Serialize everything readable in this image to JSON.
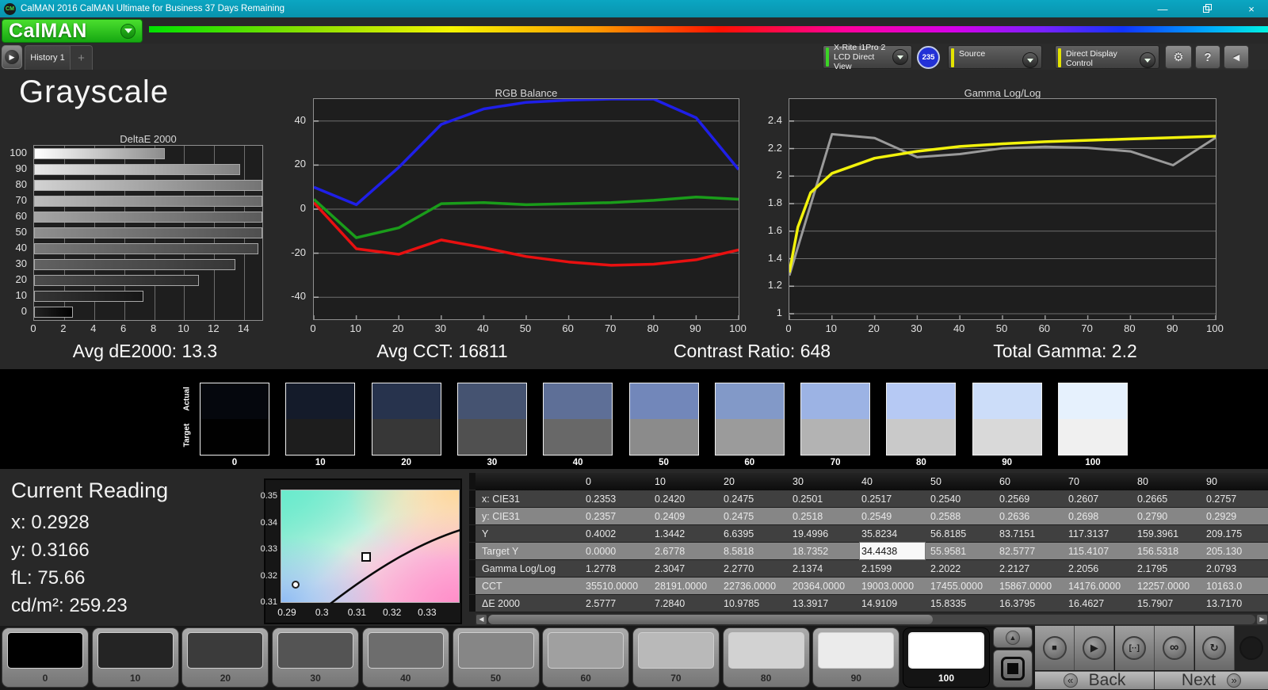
{
  "window": {
    "icon_text": "CM",
    "title": "CalMAN 2016 CalMAN Ultimate for Business 37 Days Remaining",
    "minimize_glyph": "—",
    "close_glyph": "×"
  },
  "brand": {
    "logo": "CalMAN"
  },
  "tabs": {
    "history": "History 1",
    "add": "+"
  },
  "toolbar": {
    "meter": {
      "line1": "X-Rite i1Pro 2",
      "line2": "LCD Direct View",
      "badge": "235",
      "accent": "#3bd425"
    },
    "source": {
      "label": "Source",
      "accent": "#e3e300"
    },
    "display_control": {
      "label": "Direct Display Control",
      "accent": "#e3e300"
    },
    "help_glyph": "?",
    "gear_glyph": "⚙",
    "collapse_glyph": "◀",
    "expander_glyph": "▶"
  },
  "colors": {
    "titlebar_teal": "#0a9db8",
    "accent_green": "#3bd425",
    "accent_yellow": "#e3e300",
    "badge_blue": "#2231d6"
  },
  "page": {
    "title": "Grayscale"
  },
  "stats": [
    "Avg dE2000: 13.3",
    "Avg CCT: 16811",
    "Contrast Ratio: 648",
    "Total Gamma: 2.2"
  ],
  "chart_data": [
    {
      "id": "deltae",
      "type": "bar",
      "orientation": "horizontal",
      "title": "DeltaE 2000",
      "categories": [
        "100",
        "90",
        "80",
        "70",
        "60",
        "50",
        "40",
        "30",
        "20",
        "10",
        "0"
      ],
      "values": [
        8.7,
        13.717,
        15.7907,
        16.4627,
        16.3795,
        15.8335,
        14.9109,
        13.3917,
        10.9785,
        7.284,
        2.5777
      ],
      "xlim": [
        0,
        15.2
      ],
      "xticks": [
        0,
        2,
        4,
        6,
        8,
        10,
        12,
        14
      ],
      "bar_color_from": [
        "#ffffff",
        "#e8e8e8",
        "#d2d2d2",
        "#bcbcbc",
        "#a5a5a5",
        "#8f8f8f",
        "#787878",
        "#626262",
        "#4b4b4b",
        "#353535",
        "#222222"
      ],
      "bar_color_to": [
        "#8c8c8c",
        "#808080",
        "#747474",
        "#686868",
        "#5b5b5b",
        "#4f4f4f",
        "#424242",
        "#363636",
        "#2a2a2a",
        "#161616",
        "#000000"
      ]
    },
    {
      "id": "rgb_balance",
      "type": "line",
      "title": "RGB Balance",
      "x": [
        0,
        10,
        20,
        30,
        40,
        50,
        60,
        70,
        80,
        90,
        100
      ],
      "xticks": [
        0,
        10,
        20,
        30,
        40,
        50,
        60,
        70,
        80,
        90,
        100
      ],
      "ylim": [
        -50,
        50
      ],
      "ytick_values": [
        40,
        20,
        0,
        -20,
        -40
      ],
      "ytick_labels": [
        "40",
        "20",
        "0",
        "-20",
        "-40"
      ],
      "series": [
        {
          "name": "Red",
          "color": "#e81010",
          "values": [
            3,
            -18,
            -20.5,
            -14,
            -17.5,
            -21.5,
            -24,
            -25.5,
            -25,
            -23,
            -18.5
          ]
        },
        {
          "name": "Green",
          "color": "#1a9c1a",
          "values": [
            4.5,
            -13,
            -8.5,
            2.5,
            3,
            2,
            2.5,
            3,
            4,
            5.5,
            4.5
          ]
        },
        {
          "name": "Blue",
          "color": "#1f1fe8",
          "values": [
            10,
            2,
            19,
            38.5,
            45.5,
            48.5,
            49.5,
            50,
            50,
            41.5,
            18
          ]
        }
      ]
    },
    {
      "id": "gamma",
      "type": "line",
      "title": "Gamma Log/Log",
      "xticks": [
        0,
        10,
        20,
        30,
        40,
        50,
        60,
        70,
        80,
        90,
        100
      ],
      "ylim": [
        0.96,
        2.56
      ],
      "ytick_values": [
        2.4,
        2.2,
        2,
        1.8,
        1.6,
        1.4,
        1.2,
        1
      ],
      "ytick_labels": [
        "2.4",
        "2.2",
        "2",
        "1.8",
        "1.6",
        "1.4",
        "1.2",
        "1"
      ],
      "series": [
        {
          "name": "Measured",
          "color": "#9a9a9a",
          "width": 3,
          "x": [
            0,
            10,
            20,
            30,
            40,
            50,
            60,
            70,
            80,
            90,
            100
          ],
          "values": [
            1.2778,
            2.3047,
            2.277,
            2.1374,
            2.1599,
            2.2022,
            2.2127,
            2.2056,
            2.1795,
            2.0793,
            2.28
          ]
        },
        {
          "name": "Target",
          "color": "#f2f20c",
          "width": 3.5,
          "x": [
            0,
            2,
            5,
            10,
            20,
            30,
            40,
            50,
            60,
            70,
            80,
            90,
            100
          ],
          "values": [
            1.3,
            1.63,
            1.88,
            2.02,
            2.13,
            2.18,
            2.215,
            2.235,
            2.25,
            2.26,
            2.27,
            2.28,
            2.29
          ]
        }
      ]
    },
    {
      "id": "cie_detail",
      "type": "scatter",
      "title": "",
      "xlim": [
        0.2882,
        0.3393
      ],
      "ylim": [
        0.31,
        0.3527
      ],
      "xtick_values": [
        0.29,
        0.3,
        0.31,
        0.32,
        0.33
      ],
      "xtick_labels": [
        "0.29",
        "0.3",
        "0.31",
        "0.32",
        "0.33"
      ],
      "ytick_values": [
        0.35,
        0.34,
        0.33,
        0.32,
        0.31
      ],
      "ytick_labels": [
        "0.35",
        "0.34",
        "0.33",
        "0.32",
        "0.31"
      ],
      "points": [
        {
          "name": "target",
          "shape": "square",
          "x": 0.3128,
          "y": 0.327
        },
        {
          "name": "current",
          "shape": "circle",
          "x": 0.2928,
          "y": 0.3166
        }
      ]
    }
  ],
  "swatches": {
    "row_labels": [
      "Actual",
      "Target"
    ],
    "levels": [
      "0",
      "10",
      "20",
      "30",
      "40",
      "50",
      "60",
      "70",
      "80",
      "90",
      "100"
    ],
    "actual_colors": [
      "#05070d",
      "#141b2a",
      "#27334d",
      "#455371",
      "#5e6f97",
      "#7287ba",
      "#8299c8",
      "#9cb3e4",
      "#b6c9f4",
      "#ccddf9",
      "#e6f1fd"
    ],
    "target_colors": [
      "#010101",
      "#1d1d1d",
      "#373737",
      "#505050",
      "#686868",
      "#8b8b8b",
      "#9b9b9b",
      "#b3b3b3",
      "#c9c9c9",
      "#d9d9d9",
      "#f0f0f0"
    ]
  },
  "current_reading": {
    "title": "Current Reading",
    "lines": [
      "x: 0.2928",
      "y: 0.3166",
      "fL: 75.66",
      "cd/m²: 259.23"
    ]
  },
  "table": {
    "columns": [
      "0",
      "10",
      "20",
      "30",
      "40",
      "50",
      "60",
      "70",
      "80",
      "90"
    ],
    "rows": [
      {
        "label": "x: CIE31",
        "values": [
          "0.2353",
          "0.2420",
          "0.2475",
          "0.2501",
          "0.2517",
          "0.2540",
          "0.2569",
          "0.2607",
          "0.2665",
          "0.2757"
        ]
      },
      {
        "label": "y: CIE31",
        "values": [
          "0.2357",
          "0.2409",
          "0.2475",
          "0.2518",
          "0.2549",
          "0.2588",
          "0.2636",
          "0.2698",
          "0.2790",
          "0.2929"
        ]
      },
      {
        "label": "Y",
        "values": [
          "0.4002",
          "1.3442",
          "6.6395",
          "19.4996",
          "35.8234",
          "56.8185",
          "83.7151",
          "117.3137",
          "159.3961",
          "209.175"
        ]
      },
      {
        "label": "Target Y",
        "values": [
          "0.0000",
          "2.6778",
          "8.5818",
          "18.7352",
          "34.4438",
          "55.9581",
          "82.5777",
          "115.4107",
          "156.5318",
          "205.130"
        ]
      },
      {
        "label": "Gamma Log/Log",
        "values": [
          "1.2778",
          "2.3047",
          "2.2770",
          "2.1374",
          "2.1599",
          "2.2022",
          "2.2127",
          "2.2056",
          "2.1795",
          "2.0793"
        ]
      },
      {
        "label": "CCT",
        "values": [
          "35510.0000",
          "28191.0000",
          "22736.0000",
          "20364.0000",
          "19003.0000",
          "17455.0000",
          "15867.0000",
          "14176.0000",
          "12257.0000",
          "10163.0"
        ]
      },
      {
        "label": "ΔE 2000",
        "values": [
          "2.5777",
          "7.2840",
          "10.9785",
          "13.3917",
          "14.9109",
          "15.8335",
          "16.3795",
          "16.4627",
          "15.7907",
          "13.7170"
        ]
      }
    ],
    "highlight": {
      "row_index": 3,
      "col_index": 4
    }
  },
  "patch_bar": {
    "levels": [
      "0",
      "10",
      "20",
      "30",
      "40",
      "50",
      "60",
      "70",
      "80",
      "90",
      "100"
    ],
    "colors": [
      "#000000",
      "#242424",
      "#3b3b3b",
      "#545454",
      "#6d6d6d",
      "#868686",
      "#a0a0a0",
      "#b9b9b9",
      "#d2d2d2",
      "#ebebeb",
      "#ffffff"
    ],
    "selected_index": 10
  },
  "transport": {
    "icons": [
      {
        "name": "stop",
        "glyph": "■"
      },
      {
        "name": "play",
        "glyph": "▶"
      },
      {
        "name": "series",
        "glyph": "[··]"
      },
      {
        "name": "continuous",
        "glyph": "∞"
      },
      {
        "name": "loop",
        "glyph": "↻"
      }
    ],
    "size_up_glyph": "▲",
    "back_arrow": "«",
    "back_label": "Back",
    "next_label": "Next",
    "next_arrow": "»"
  }
}
